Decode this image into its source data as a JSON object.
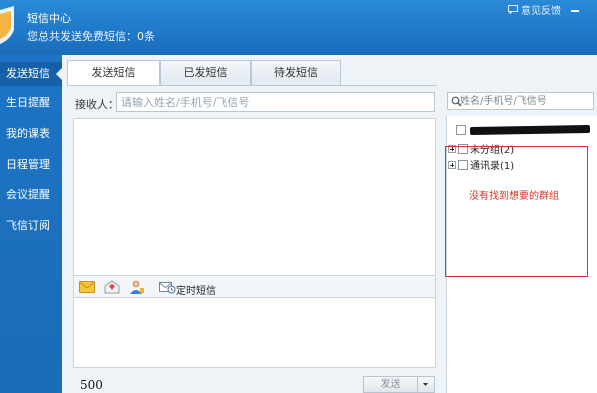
{
  "app": {
    "title": "短信中心",
    "subtitle": "您总共发送免费短信：0条",
    "feedback": "意见反馈"
  },
  "sidebar": {
    "items": [
      {
        "label": "发送短信",
        "active": true
      },
      {
        "label": "生日提醒"
      },
      {
        "label": "我的课表"
      },
      {
        "label": "日程管理"
      },
      {
        "label": "会议提醒"
      },
      {
        "label": "飞信订阅"
      }
    ]
  },
  "tabs": [
    {
      "label": "发送短信",
      "active": true
    },
    {
      "label": "已发短信"
    },
    {
      "label": "待发短信"
    }
  ],
  "compose": {
    "recipient_label": "接收人：",
    "recipient_placeholder": "请输入姓名/手机号/飞信号",
    "timed_label": "定时短信",
    "char_count": "500",
    "send_label": "发送"
  },
  "contacts": {
    "search_placeholder": "姓名/手机号/飞信号",
    "groups": [
      {
        "label": "未分组(2)"
      },
      {
        "label": "通讯录(1)"
      }
    ],
    "annotation": "没有找到想要的群组"
  },
  "colors": {
    "header": "#1f78c8",
    "sidebar": "#1a6cb8",
    "annotation": "#d9342b"
  }
}
